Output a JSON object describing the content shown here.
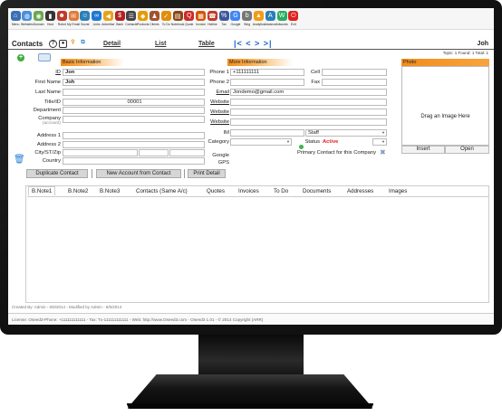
{
  "toolbar": [
    {
      "label": "Menu",
      "icon": "home-icon",
      "color": "#3b6fb6"
    },
    {
      "label": "Websites",
      "icon": "globe-icon",
      "color": "#4a90d9"
    },
    {
      "label": "Domain",
      "icon": "domain-icon",
      "color": "#6aa84f"
    },
    {
      "label": "Host",
      "icon": "server-icon",
      "color": "#333333"
    },
    {
      "label": "Robot",
      "icon": "robot-icon",
      "color": "#c0392b"
    },
    {
      "label": "My Email",
      "icon": "email-icon",
      "color": "#e07b39"
    },
    {
      "label": "Social",
      "icon": "social-icon",
      "color": "#2c7fb8"
    },
    {
      "label": "Links",
      "icon": "links-icon",
      "color": "#1f78d1"
    },
    {
      "label": "Advertise",
      "icon": "megaphone-icon",
      "color": "#e8a317"
    },
    {
      "label": "Bank",
      "icon": "bank-icon",
      "color": "#b22222"
    },
    {
      "label": "Contacts",
      "icon": "contacts-icon",
      "color": "#444444"
    },
    {
      "label": "Products",
      "icon": "products-icon",
      "color": "#e69b00"
    },
    {
      "label": "Clients",
      "icon": "clients-icon",
      "color": "#a0522d"
    },
    {
      "label": "To Do",
      "icon": "todo-icon",
      "color": "#e08e0b"
    },
    {
      "label": "Notebook",
      "icon": "notebook-icon",
      "color": "#8b4513"
    },
    {
      "label": "Quote",
      "icon": "quote-icon",
      "color": "#cc2a2a"
    },
    {
      "label": "Invoice",
      "icon": "invoice-icon",
      "color": "#d35400"
    },
    {
      "label": "Hotline",
      "icon": "phone-icon",
      "color": "#c0392b"
    },
    {
      "label": "Tax",
      "icon": "tax-icon",
      "color": "#3b5998"
    },
    {
      "label": "Google",
      "icon": "google-icon",
      "color": "#4285f4"
    },
    {
      "label": "Bing",
      "icon": "bing-icon",
      "color": "#777777"
    },
    {
      "label": "Analytics",
      "icon": "analytics-icon",
      "color": "#f39c12"
    },
    {
      "label": "Advance",
      "icon": "advance-icon",
      "color": "#2980b9"
    },
    {
      "label": "Adwords",
      "icon": "adwords-icon",
      "color": "#27ae60"
    },
    {
      "label": "Exit",
      "icon": "power-icon",
      "color": "#e02020"
    }
  ],
  "nav": {
    "title": "Contacts",
    "tabs": [
      "Detail",
      "List",
      "Table"
    ],
    "arrows": "|< < > >|",
    "user": "Joh",
    "topic_info": "Topic: 1 Found: 1 Total: 1"
  },
  "basic": {
    "header": "Basic Information",
    "id_label": "ID",
    "id_value": "Jon",
    "first_name_label": "First Name",
    "first_name_value": "Joh",
    "last_name_label": "Last Name",
    "last_name_value": "",
    "title_label": "Title/ID",
    "title_value": "00001",
    "department_label": "Department",
    "department_value": "",
    "company_label": "Company",
    "company_sub": "(account)",
    "company_value": "",
    "address1_label": "Address 1",
    "address1_value": "",
    "address2_label": "Address 2",
    "address2_value": "",
    "city_label": "City/ST/Zip",
    "country_label": "Country",
    "country_value": ""
  },
  "more": {
    "header": "More Information",
    "phone1_label": "Phone 1",
    "phone1_value": "+111111111",
    "phone2_label": "Phone 2",
    "phone2_value": "",
    "cell_label": "Cell",
    "cell_value": "",
    "fax_label": "Fax",
    "fax_value": "",
    "email_label": "Email",
    "email_value": "Jondemo@gmail.com",
    "website_label": "Website",
    "im_label": "IM",
    "im_type": "Staff",
    "category_label": "Category",
    "status_label": "Status",
    "status_value": "Active",
    "status_color": "#e02020",
    "primary_label": "Primary Contact for this Company",
    "google_label": "Google",
    "gps_label": "GPS"
  },
  "photo": {
    "header": "Photo",
    "drag_text": "Drag an Image Here",
    "insert_label": "Insert",
    "open_label": "Open"
  },
  "actions": {
    "duplicate": "Duplicate Contact",
    "new_account": "New Account from Contact",
    "print": "Print Detail"
  },
  "tabs": [
    "B.Note1",
    "B.Note2",
    "B.Note3",
    "Contacts (Same A/c)",
    "Quotes",
    "Invoices",
    "To Do",
    "Documents",
    "Addresses",
    "Images"
  ],
  "created": "Created By: Admin - 6/5/2014 - Modified by Admin - 6/5/2014",
  "footer": "License: Oseed3-Phone: +111111111111 - Tax: Tx-111111111111 - Web: http://www.Oseed3.com - Oseed3 1.01 - © 2014 Copyright (ARR)"
}
